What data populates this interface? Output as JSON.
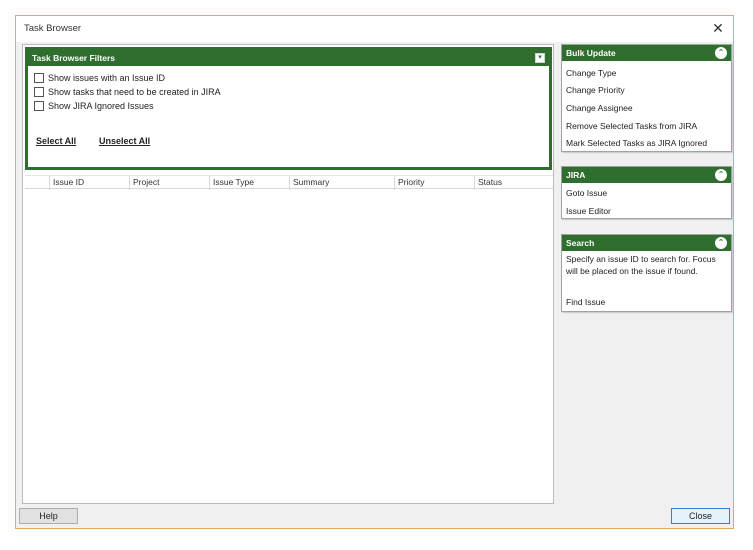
{
  "window": {
    "title": "Task Browser"
  },
  "filters": {
    "title": "Task Browser Filters",
    "options": [
      {
        "label": "Show issues with an Issue ID",
        "checked": false
      },
      {
        "label": "Show tasks that need to be created in JIRA",
        "checked": false
      },
      {
        "label": "Show JIRA Ignored Issues",
        "checked": false
      }
    ],
    "select_all": "Select All",
    "unselect_all": "Unselect All"
  },
  "grid": {
    "columns": [
      "Issue ID",
      "Project",
      "Issue Type",
      "Summary",
      "Priority",
      "Status"
    ]
  },
  "bulk_update": {
    "title": "Bulk Update",
    "items": [
      "Change Type",
      "Change Priority",
      "Change Assignee",
      "Remove Selected Tasks from JIRA",
      "Mark Selected Tasks as JIRA Ignored"
    ]
  },
  "jira": {
    "title": "JIRA",
    "items": [
      "Goto Issue",
      "Issue Editor"
    ]
  },
  "search": {
    "title": "Search",
    "description": "Specify an issue ID to search for. Focus will be placed on the issue if found.",
    "find_label": "Find Issue"
  },
  "footer": {
    "help": "Help",
    "close": "Close"
  },
  "colors": {
    "accent_green": "#2f6e2e",
    "window_border": "#e0a95e"
  }
}
